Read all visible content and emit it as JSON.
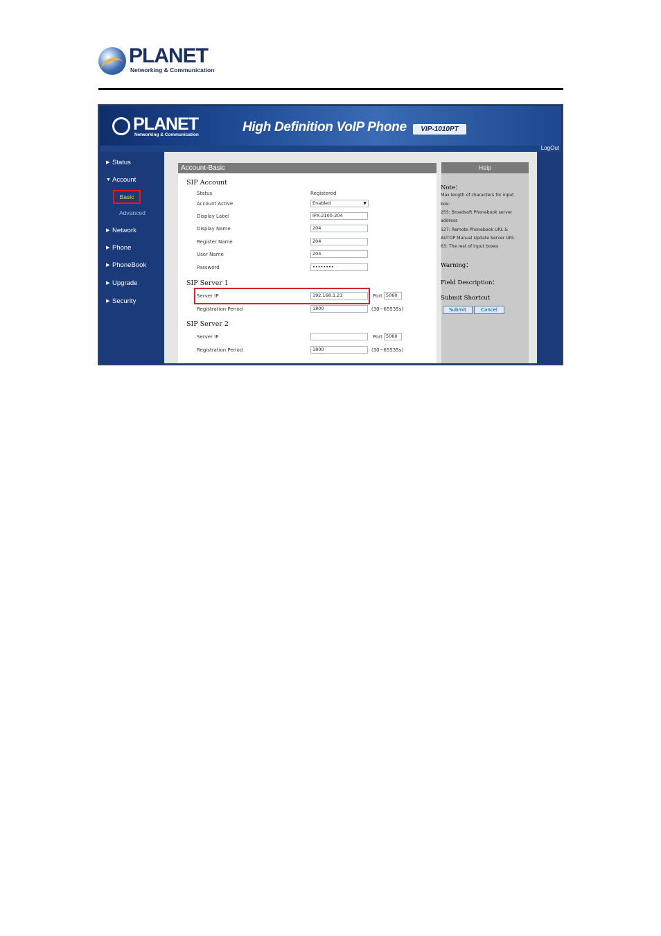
{
  "doc_logo": {
    "brand": "PLANET",
    "tagline": "Networking & Communication"
  },
  "banner": {
    "brand": "PLANET",
    "tagline": "Networking & Communication",
    "title": "High Definition VoIP Phone",
    "model": "VIP-1010PT"
  },
  "logout": "LogOut",
  "sidebar": {
    "items": [
      {
        "label": "Status",
        "arrow": "▶"
      },
      {
        "label": "Account",
        "arrow": "▼"
      },
      {
        "label": "Network",
        "arrow": "▶"
      },
      {
        "label": "Phone",
        "arrow": "▶"
      },
      {
        "label": "PhoneBook",
        "arrow": "▶"
      },
      {
        "label": "Upgrade",
        "arrow": "▶"
      },
      {
        "label": "Security",
        "arrow": "▶"
      }
    ],
    "sub_basic": "Basic",
    "sub_advanced": "Advanced"
  },
  "main": {
    "heading": "Account-Basic",
    "sip_account": {
      "title": "SIP Account",
      "status_label": "Status",
      "status_value": "Registered",
      "active_label": "Account Active",
      "active_value": "Enabled",
      "display_label_label": "Display Label",
      "display_label_value": "IPX-2100-204",
      "display_name_label": "Display Name",
      "display_name_value": "204",
      "register_name_label": "Register Name",
      "register_name_value": "204",
      "user_name_label": "User Name",
      "user_name_value": "204",
      "password_label": "Password",
      "password_value": "••••••••"
    },
    "server1": {
      "title": "SIP Server 1",
      "ip_label": "Server IP",
      "ip_value": "192.168.1.21",
      "port_label": "Port",
      "port_value": "5060",
      "period_label": "Registration Period",
      "period_value": "1800",
      "period_range": "(30~65535s)"
    },
    "server2": {
      "title": "SIP Server 2",
      "ip_label": "Server IP",
      "ip_value": "",
      "port_label": "Port",
      "port_value": "5060",
      "period_label": "Registration Period",
      "period_value": "1800",
      "period_range": "(30~65535s)"
    }
  },
  "help": {
    "title": "Help",
    "note_title": "Note：",
    "note_lines": [
      "Max length of characters for input",
      "box:",
      "255: Broadsoft Phonebook server",
      "address",
      "127: Remote Phonebook URL &",
      "AUTOP Manual Update Server URL",
      "63: The rest of input boxes"
    ],
    "warning_title": "Warning：",
    "field_title": "Field Description：",
    "shortcut_title": "Submit Shortcut",
    "submit": "Submit",
    "cancel": "Cancel"
  }
}
